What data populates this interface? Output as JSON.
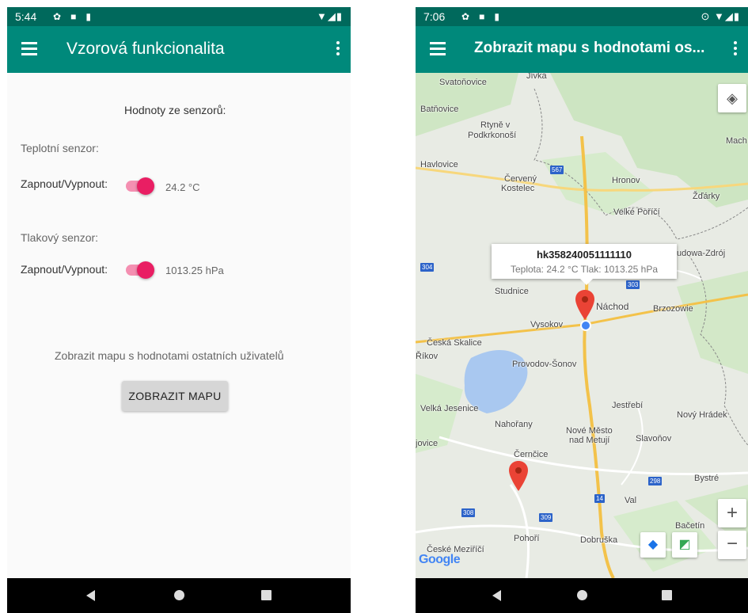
{
  "left_screen": {
    "status_time": "5:44",
    "title": "Vzorová funkcionalita",
    "sensors_heading": "Hodnoty ze senzorů:",
    "temperature": {
      "label": "Teplotní senzor:",
      "toggle_label": "Zapnout/Vypnout:",
      "value": "24.2 °C",
      "enabled": true
    },
    "pressure": {
      "label": "Tlakový senzor:",
      "toggle_label": "Zapnout/Vypnout:",
      "value": "1013.25 hPa",
      "enabled": true
    },
    "map_prompt": "Zobrazit mapu s hodnotami ostatních uživatelů",
    "map_button": "ZOBRAZIT MAPU"
  },
  "right_screen": {
    "status_time": "7:06",
    "title": "Zobrazit mapu s hodnotami os...",
    "info_window": {
      "title": "hk358240051111110",
      "body": "Teplota: 24.2 °C  Tlak: 1013.25 hPa"
    },
    "places": [
      "Svatoňovice",
      "Jívka",
      "Batňovice",
      "Rtyně v",
      "Podkrkonoší",
      "Havlovice",
      "Červený",
      "Kostelec",
      "Hronov",
      "Žďárky",
      "Mach",
      "Velké Poříčí",
      "udowa-Zdrój",
      "Studnice",
      "Náchod",
      "Brzozowie",
      "Vysokov",
      "Česká Skalice",
      "Říkov",
      "Provodov-Šonov",
      "Velká Jesenice",
      "Jestřebí",
      "Nový Hrádek",
      "Nahořany",
      "Nové Město",
      "nad Metují",
      "jovice",
      "Slavoňov",
      "Černčice",
      "Bystré",
      "Val",
      "Bačetín",
      "Pohoří",
      "Dobruška",
      "České Meziříčí"
    ],
    "route_shields": [
      "567",
      "304",
      "303",
      "298",
      "14",
      "308",
      "309"
    ],
    "zoom_in": "+",
    "zoom_out": "−",
    "attribution": "Google"
  },
  "colors": {
    "appbar": "#00897b",
    "statusbar": "#00695c",
    "switch_thumb": "#e91e63",
    "switch_track": "#f48fb1",
    "marker": "#ea4335"
  },
  "icons": [
    "menu-icon",
    "more-vert-icon",
    "gear-icon",
    "square-icon",
    "sim-icon",
    "wifi-icon",
    "signal-icon",
    "battery-icon",
    "location-icon",
    "my-location-icon",
    "directions-icon",
    "google-maps-icon",
    "map-marker-icon",
    "back-icon",
    "home-icon",
    "recents-icon"
  ]
}
